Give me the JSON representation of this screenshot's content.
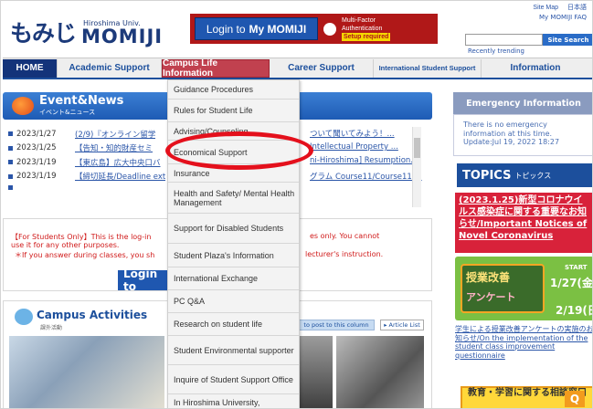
{
  "header": {
    "logo_jp": "もみじ",
    "logo_univ": "Hiroshima Univ.",
    "logo_momiji": "MOMIJI",
    "login_prefix": "Login to",
    "login_bold": "My MOMIJI",
    "mfa_line1": "Multi-Factor",
    "mfa_line2": "Authentication",
    "mfa_setup": "Setup required",
    "top_link1": "Site Map",
    "top_link2": "日本語",
    "top_link3": "My MOMIJI FAQ",
    "search_placeholder": "",
    "search_button": "Site Search",
    "recently_trending": "Recently trending"
  },
  "nav": {
    "home": "HOME",
    "academic": "Academic Support",
    "campus_life": "Campus Life Information",
    "career": "Career Support",
    "international": "International Student Support",
    "information": "Information"
  },
  "dropdown": {
    "items": [
      "Guidance Procedures",
      "Rules for Student Life",
      "Advising/Counseling",
      "Economical Support",
      "Insurance",
      "Health and Safety/ Mental Health Management",
      "Support for Disabled Students",
      "Student Plaza's Information",
      "International Exchange",
      "PC Q&A",
      "Research on student life",
      "Student Environmental supporter",
      "Inquire of Student Support Office",
      "In Hiroshima University,"
    ]
  },
  "event": {
    "title": "Event&News",
    "subtitle": "イベント&ニュース",
    "items": [
      {
        "date": "2023/1/27",
        "text": "(2/9)『オンライン留学",
        "tail": "ついて聞いてみよう！..."
      },
      {
        "date": "2023/1/25",
        "text": "【告知・知的財産セミ",
        "tail": "Intellectual Property ..."
      },
      {
        "date": "2023/1/19",
        "text": "【東広島】広大中央口バ",
        "tail": "ni-Hiroshima] Resumption..."
      },
      {
        "date": "2023/1/19",
        "text": "【締切延長/Deadline ext",
        "tail": "グラム Course11/Course11,..."
      },
      {
        "date": "",
        "text": "",
        "tail": ""
      }
    ]
  },
  "notice": {
    "line1": "【For Students Only】This is the log-in",
    "line1_tail": "es only.  You cannot",
    "line2": "use it for any other purposes.",
    "line3": "＊If you answer during classes, you sh",
    "line3_tail": "lecturer's instruction.",
    "login_button": "Login to"
  },
  "campus": {
    "title": "Campus Activities",
    "subtitle": "課外活動",
    "post_button": "to post to this column",
    "article_list": "▸ Article List"
  },
  "emergency": {
    "title": "Emergency Information",
    "line1": "There is no emergency",
    "line2": "information at this time.",
    "line3": "Update:Jul 19, 2022 18:27"
  },
  "topics": {
    "title": "TOPICS",
    "subtitle": "トピックス",
    "corona": "(2023.1.25)新型コロナウイルス感染症に関する重要なお知らせ/Important Notices of Novel Coronavirus",
    "survey_t1": "授業改善",
    "survey_t2": "アンケート",
    "survey_start": "START",
    "survey_d1": "1/27(金)",
    "survey_d2": "2/19(日)",
    "survey_note": "学生による授業改善アンケートの実施のお知らせ/On the implementation of the student class improvement questionnaire",
    "edu_banner": "教育・学習に関する相談窓口"
  }
}
